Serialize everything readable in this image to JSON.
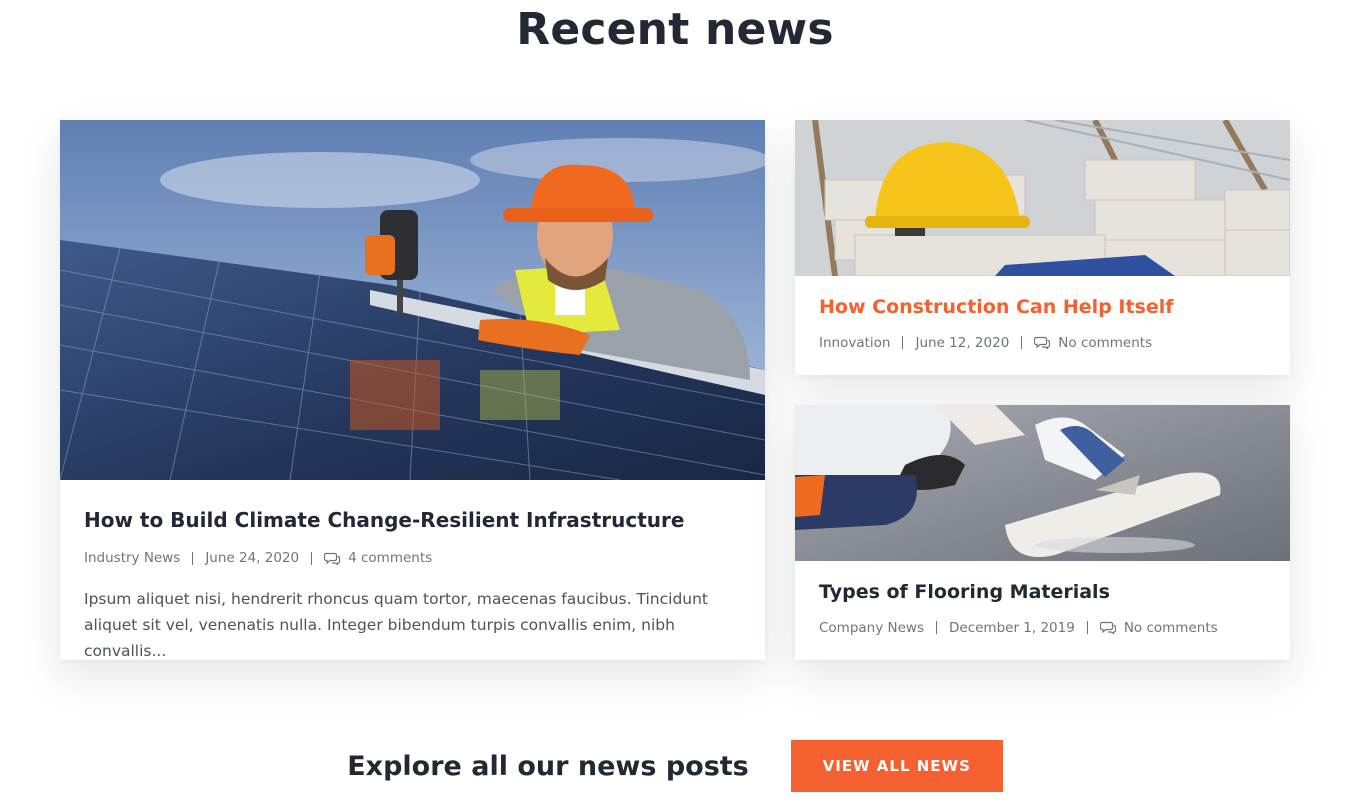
{
  "section": {
    "title": "Recent news"
  },
  "posts": [
    {
      "title": "How to Build Climate Change-Resilient Infrastructure",
      "category": "Industry News",
      "date": "June 24, 2020",
      "comments": "4 comments",
      "excerpt": "Ipsum aliquet nisi, hendrerit rhoncus quam tortor, maecenas faucibus. Tincidunt aliquet sit vel, venenatis nulla. Integer bibendum turpis convallis enim, nibh convallis...",
      "image": "worker-drilling-solar-panel"
    },
    {
      "title": "How Construction Can Help Itself",
      "category": "Innovation",
      "date": "June 12, 2020",
      "comments": "No comments",
      "image": "yellow-hardhat-on-bricks"
    },
    {
      "title": "Types of Flooring Materials",
      "category": "Company News",
      "date": "December 1, 2019",
      "comments": "No comments",
      "image": "worker-trowelling-concrete-floor"
    }
  ],
  "cta": {
    "text": "Explore all our news posts",
    "button": "VIEW ALL NEWS"
  },
  "colors": {
    "accent": "#f4602f",
    "heading": "#222834",
    "meta": "#6f7480",
    "body": "#4c5260"
  }
}
